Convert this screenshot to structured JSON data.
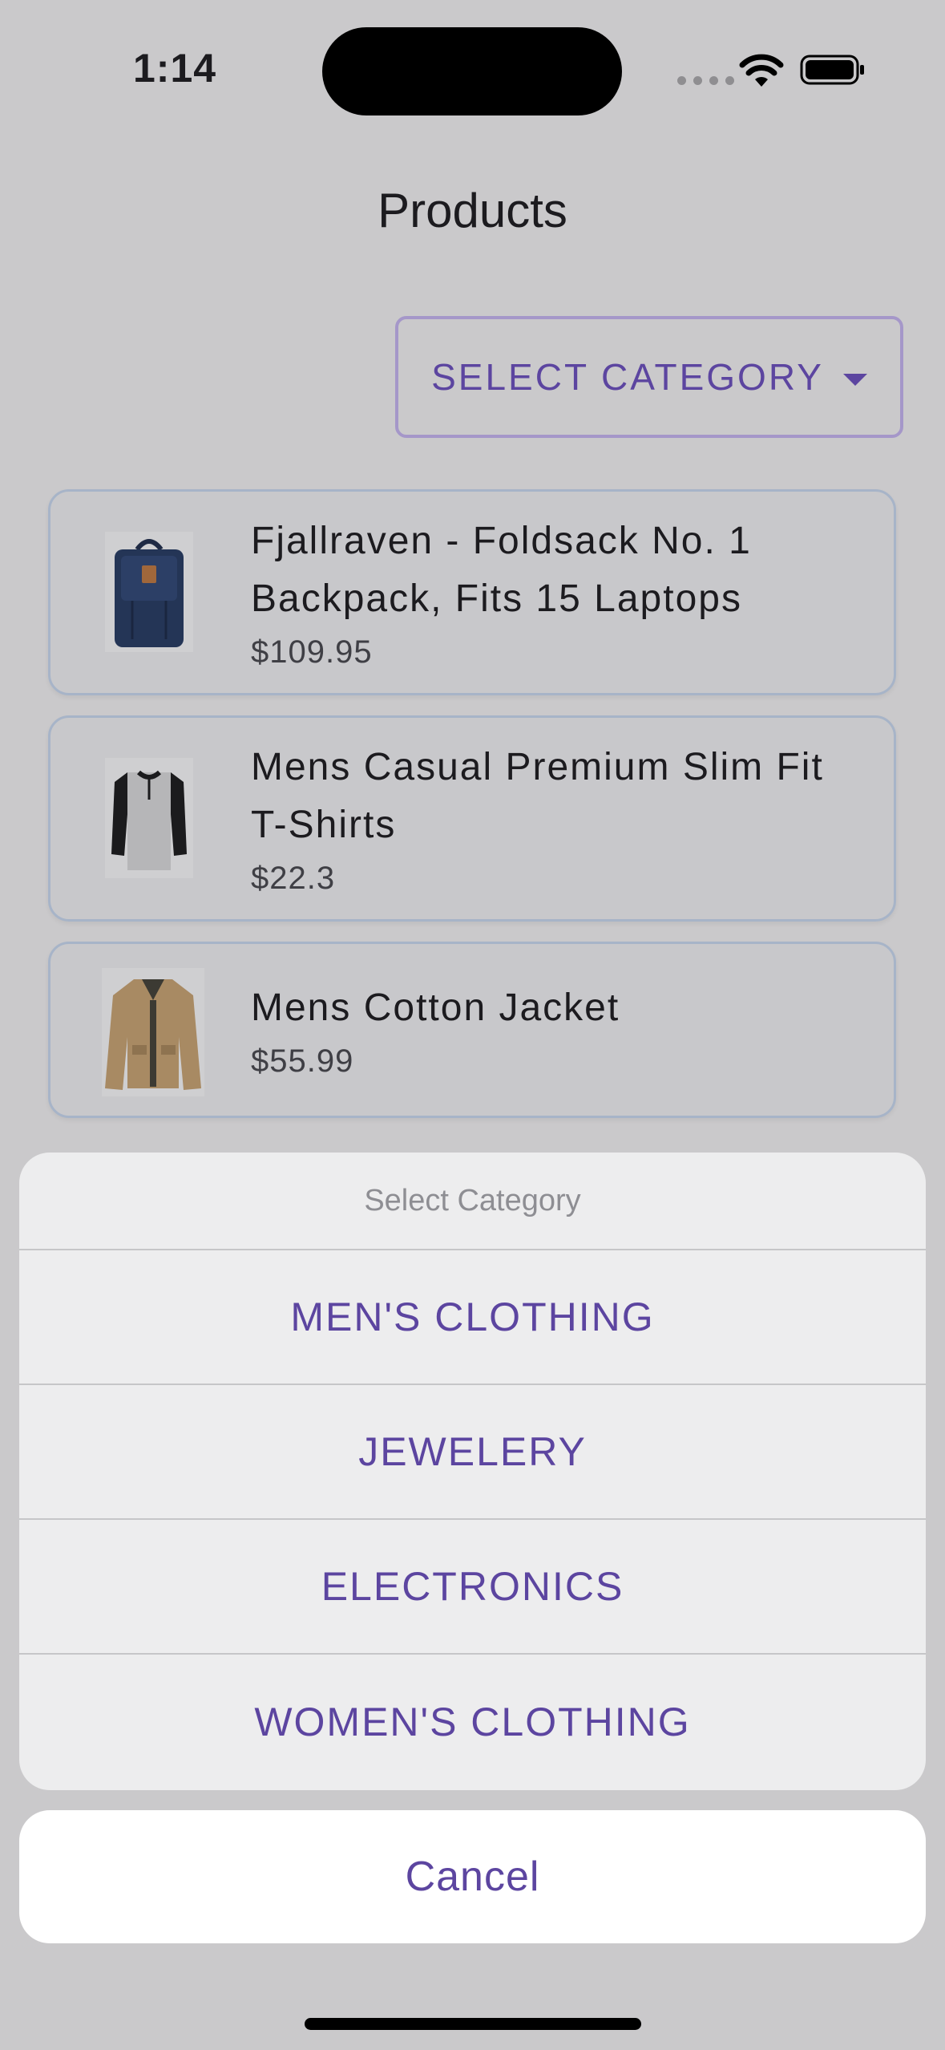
{
  "status_bar": {
    "time": "1:14"
  },
  "header": {
    "title": "Products"
  },
  "filter": {
    "label": "SELECT CATEGORY"
  },
  "products": [
    {
      "name": "Fjallraven - Foldsack No. 1 Backpack, Fits 15 Laptops",
      "price": "$109.95",
      "image_icon": "backpack-icon"
    },
    {
      "name": "Mens Casual Premium Slim Fit T-Shirts",
      "price": "$22.3",
      "image_icon": "tshirt-icon"
    },
    {
      "name": "Mens Cotton Jacket",
      "price": "$55.99",
      "image_icon": "jacket-icon"
    }
  ],
  "action_sheet": {
    "title": "Select Category",
    "options": [
      "MEN'S CLOTHING",
      "JEWELERY",
      "ELECTRONICS",
      "WOMEN'S CLOTHING"
    ],
    "cancel_label": "Cancel"
  },
  "colors": {
    "accent": "#5c45a0",
    "background": "#cac9cb",
    "card_border": "#a7b4c8"
  }
}
